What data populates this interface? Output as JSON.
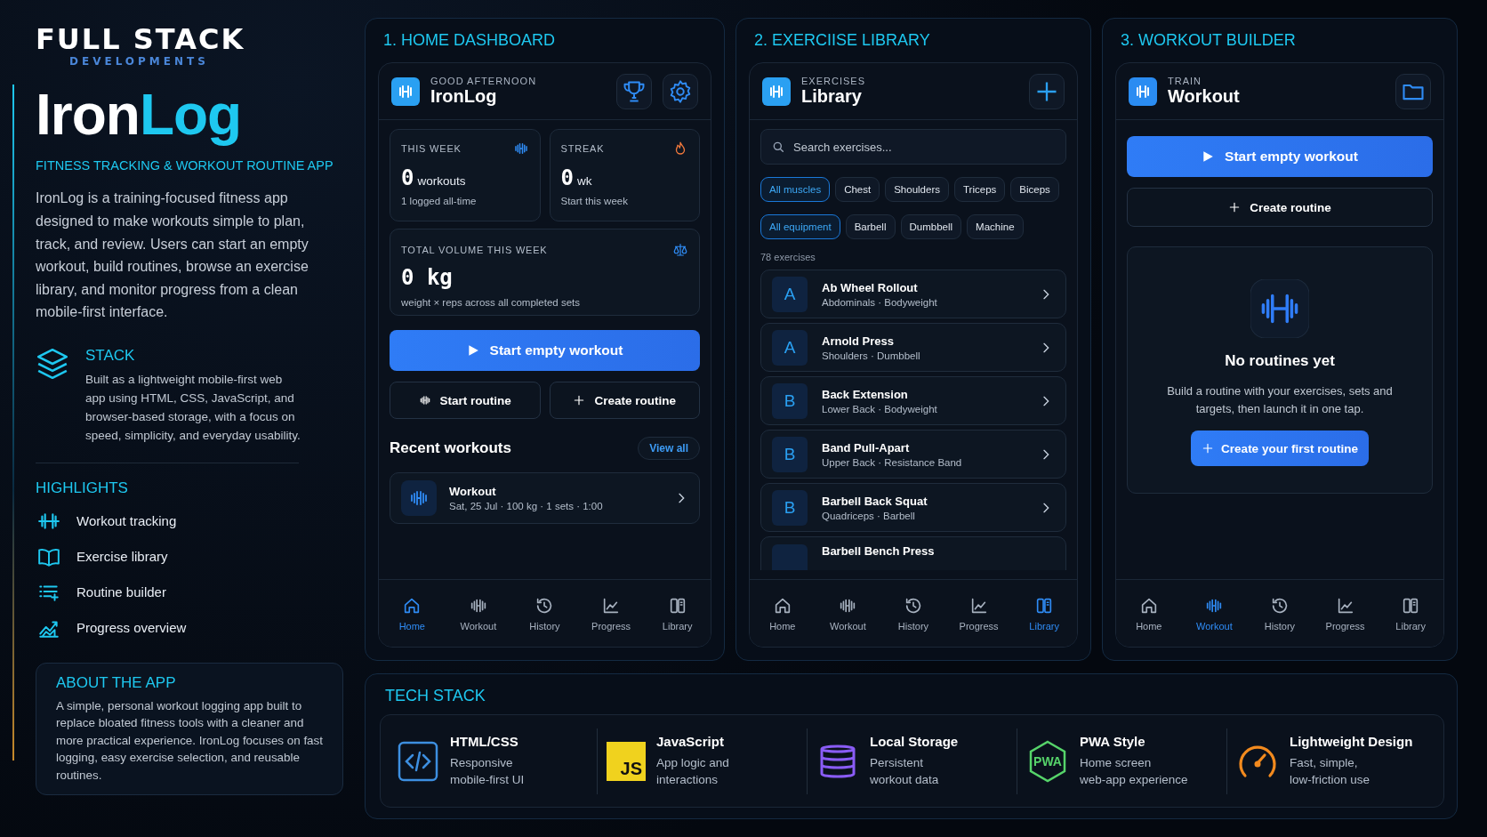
{
  "brand": {
    "name": "FULL STACK",
    "sub": "DEVELOPMENTS"
  },
  "app": {
    "name_start": "Iron",
    "name_end": "Log",
    "tagline": "FITNESS TRACKING & WORKOUT ROUTINE APP",
    "description": "IronLog is a training-focused fitness app designed to make workouts simple to plan, track, and review. Users can start an empty workout, build routines, browse an exercise library, and monitor progress from a clean mobile-first interface."
  },
  "stack": {
    "title": "STACK",
    "text": "Built as a lightweight mobile-first web app using HTML, CSS, JavaScript, and browser-based storage, with a focus on speed, simplicity, and everyday usability."
  },
  "highlights": {
    "title": "HIGHLIGHTS",
    "items": [
      "Workout tracking",
      "Exercise library",
      "Routine builder",
      "Progress overview"
    ]
  },
  "about": {
    "title": "ABOUT THE APP",
    "text": "A simple, personal workout logging app built to replace bloated fitness tools with a cleaner and more practical experience. IronLog focuses on fast logging, easy exercise selection, and reusable routines."
  },
  "home": {
    "title": "1. HOME DASHBOARD",
    "kicker": "GOOD AFTERNOON",
    "heading": "IronLog",
    "stats": [
      {
        "label": "THIS WEEK",
        "value": "0",
        "unit": "workouts",
        "note": "1 logged all-time"
      },
      {
        "label": "STREAK",
        "value": "0",
        "unit": "wk",
        "note": "Start this week"
      }
    ],
    "volume": {
      "label": "TOTAL VOLUME THIS WEEK",
      "value": "0 kg",
      "note": "weight × reps across all completed sets"
    },
    "primary_button": "Start empty workout",
    "buttons": [
      "Start routine",
      "Create routine"
    ],
    "recent_title": "Recent workouts",
    "view_all": "View all",
    "recent": [
      {
        "name": "Workout",
        "meta": "Sat, 25 Jul · 100 kg · 1 sets · 1:00"
      }
    ],
    "nav": [
      {
        "label": "Home",
        "selected": true
      },
      {
        "label": "Workout",
        "selected": false
      },
      {
        "label": "History",
        "selected": false
      },
      {
        "label": "Progress",
        "selected": false
      },
      {
        "label": "Library",
        "selected": false
      }
    ]
  },
  "library": {
    "title": "2. EXERCIISE LIBRARY",
    "kicker": "EXERCISES",
    "heading": "Library",
    "search": {
      "placeholder": "Search exercises..."
    },
    "muscles": [
      {
        "label": "All muscles",
        "selected": true
      },
      {
        "label": "Chest",
        "selected": false
      },
      {
        "label": "Shoulders",
        "selected": false
      },
      {
        "label": "Triceps",
        "selected": false
      },
      {
        "label": "Biceps",
        "selected": false
      }
    ],
    "equipment": [
      {
        "label": "All equipment",
        "selected": true
      },
      {
        "label": "Barbell",
        "selected": false
      },
      {
        "label": "Dumbbell",
        "selected": false
      },
      {
        "label": "Machine",
        "selected": false
      }
    ],
    "count": "78 exercises",
    "exercises": [
      {
        "initial": "A",
        "name": "Ab Wheel Rollout",
        "meta": "Abdominals · Bodyweight"
      },
      {
        "initial": "A",
        "name": "Arnold Press",
        "meta": "Shoulders · Dumbbell"
      },
      {
        "initial": "B",
        "name": "Back Extension",
        "meta": "Lower Back · Bodyweight"
      },
      {
        "initial": "B",
        "name": "Band Pull-Apart",
        "meta": "Upper Back · Resistance Band"
      },
      {
        "initial": "B",
        "name": "Barbell Back Squat",
        "meta": "Quadriceps · Barbell"
      },
      {
        "name": "Barbell Bench Press"
      }
    ],
    "nav": [
      {
        "label": "Home",
        "selected": false
      },
      {
        "label": "Workout",
        "selected": false
      },
      {
        "label": "History",
        "selected": false
      },
      {
        "label": "Progress",
        "selected": false
      },
      {
        "label": "Library",
        "selected": true
      }
    ]
  },
  "builder": {
    "title": "3. WORKOUT BUILDER",
    "kicker": "TRAIN",
    "heading": "Workout",
    "primary_button": "Start empty workout",
    "secondary_button": "Create routine",
    "empty": {
      "title": "No routines yet",
      "text": "Build a routine with your exercises, sets and targets, then launch it in one tap.",
      "button": "Create your first routine"
    },
    "nav": [
      {
        "label": "Home",
        "selected": false
      },
      {
        "label": "Workout",
        "selected": true
      },
      {
        "label": "History",
        "selected": false
      },
      {
        "label": "Progress",
        "selected": false
      },
      {
        "label": "Library",
        "selected": false
      }
    ]
  },
  "tech": {
    "title": "TECH STACK",
    "items": [
      {
        "name": "HTML/CSS",
        "text": "Responsive\nmobile-first UI"
      },
      {
        "badge": "JS",
        "name": "JavaScript",
        "text": "App logic and\ninteractions"
      },
      {
        "name": "Local Storage",
        "text": "Persistent\nworkout data"
      },
      {
        "badge": "PWA",
        "name": "PWA Style",
        "text": "Home screen\nweb-app experience"
      },
      {
        "name": "Lightweight Design",
        "text": "Fast, simple,\nlow-friction use"
      }
    ]
  }
}
